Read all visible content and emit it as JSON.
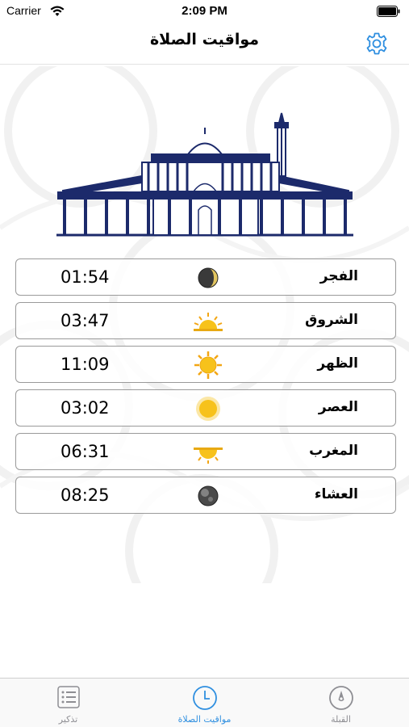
{
  "status_bar": {
    "carrier": "Carrier",
    "time": "2:09 PM"
  },
  "nav": {
    "title": "مواقيت الصلاة",
    "settings_icon": "gear-icon"
  },
  "prayers": [
    {
      "name": "الفجر",
      "time": "01:54",
      "icon": "moon-crescent-icon"
    },
    {
      "name": "الشروق",
      "time": "03:47",
      "icon": "sunrise-icon"
    },
    {
      "name": "الظهر",
      "time": "11:09",
      "icon": "sun-icon"
    },
    {
      "name": "العصر",
      "time": "03:02",
      "icon": "sun-soft-icon"
    },
    {
      "name": "المغرب",
      "time": "06:31",
      "icon": "sunset-icon"
    },
    {
      "name": "العشاء",
      "time": "08:25",
      "icon": "dark-moon-icon"
    }
  ],
  "tabs": [
    {
      "label": "تذكير",
      "icon": "list-icon"
    },
    {
      "label": "مواقيت الصلاة",
      "icon": "clock-icon",
      "active": true
    },
    {
      "label": "القبلة",
      "icon": "compass-icon"
    }
  ],
  "colors": {
    "accent": "#2f8fe0",
    "mosque": "#1c2a6b"
  }
}
